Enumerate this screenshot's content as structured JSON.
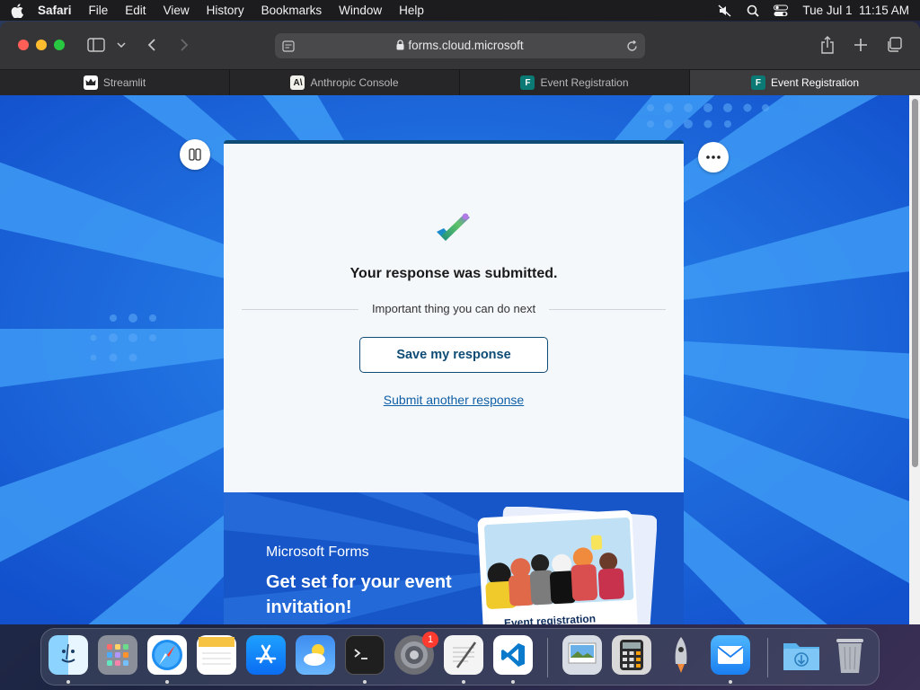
{
  "menubar": {
    "app_name": "Safari",
    "items": [
      "File",
      "Edit",
      "View",
      "History",
      "Bookmarks",
      "Window",
      "Help"
    ],
    "clock": "Tue Jul 1  11:15 AM"
  },
  "browser": {
    "url": "forms.cloud.microsoft",
    "tabs": [
      {
        "label": "Streamlit",
        "active": false
      },
      {
        "label": "Anthropic Console",
        "active": false
      },
      {
        "label": "Event Registration",
        "active": false
      },
      {
        "label": "Event Registration",
        "active": true
      }
    ]
  },
  "form": {
    "confirmation_title": "Your response was submitted.",
    "next_heading": "Important thing you can do next",
    "save_button": "Save my response",
    "submit_another_link": "Submit another response"
  },
  "promo": {
    "brand": "Microsoft Forms",
    "headline": "Get set for your event invitation!",
    "card_caption": "Event registration"
  },
  "dock": {
    "settings_badge": "1"
  },
  "colors": {
    "page_background": "#1a6ee0",
    "accent": "#0f4c75",
    "link": "#0f5fa6",
    "promo_background": "#1656c9"
  }
}
